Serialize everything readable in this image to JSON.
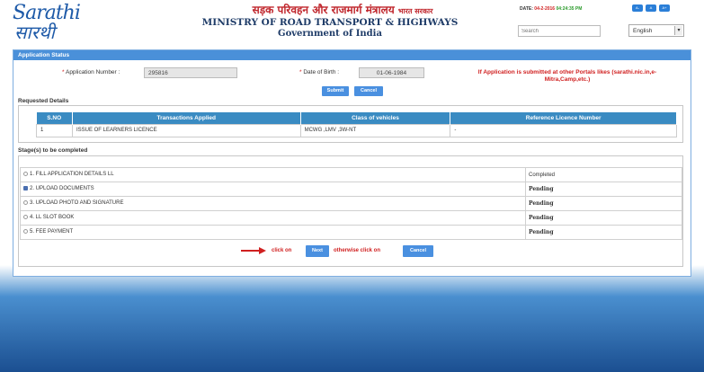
{
  "header": {
    "logo_en": "Sarathi",
    "logo_hi": "सारथी",
    "hindi_title": "सड़क परिवहन और राजमार्ग मंत्रालय",
    "hindi_sub": "भारत सरकार",
    "title": "MINISTRY OF ROAD TRANSPORT & HIGHWAYS",
    "subtitle": "Government of India",
    "date_label": "DATE:",
    "date_value": "04-2-2016",
    "time_value": "04:24:35 PM",
    "font_buttons": [
      "A-",
      "A",
      "A+"
    ],
    "search_placeholder": "Search",
    "language": "English"
  },
  "panel": {
    "title": "Application Status",
    "app_number_label": "Application Number :",
    "app_number_value": "295816",
    "dob_label": "Date of Birth :",
    "dob_value": "01-06-1984",
    "notice": "If Application is submitted at other Portals likes (sarathi.nic.in,e-Mitra,Camp,etc.)",
    "submit_label": "Submit",
    "cancel_label": "Cancel"
  },
  "requested": {
    "title": "Requested Details",
    "columns": [
      "S.NO",
      "Transactions Applied",
      "Class of vehicles",
      "Reference Licence Number"
    ],
    "rows": [
      [
        "1",
        "ISSUE OF LEARNERS LICENCE",
        "MCWG ,LMV ,3W-NT",
        "-"
      ]
    ]
  },
  "stages": {
    "title": "Stage(s) to be completed",
    "items": [
      {
        "label": "1.  FILL APPLICATION DETAILS LL",
        "status": "Completed",
        "selected": false
      },
      {
        "label": "2.  UPLOAD DOCUMENTS",
        "status": "Pending",
        "selected": true
      },
      {
        "label": "3.  UPLOAD PHOTO AND SIGNATURE",
        "status": "Pending",
        "selected": false
      },
      {
        "label": "4.  LL SLOT BOOK",
        "status": "Pending",
        "selected": false
      },
      {
        "label": "5.  FEE PAYMENT",
        "status": "Pending",
        "selected": false
      }
    ]
  },
  "actions": {
    "click_on": "click on",
    "next_label": "Next",
    "otherwise": "otherwise click on",
    "cancel_label": "Cancel"
  },
  "colors": {
    "accent": "#4a90d9",
    "pending": "#d02020"
  }
}
